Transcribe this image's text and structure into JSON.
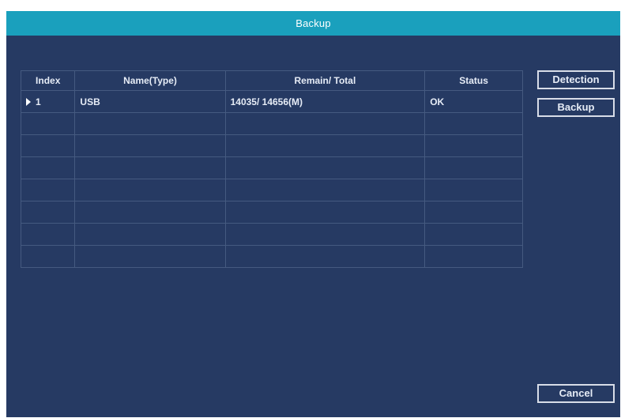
{
  "window": {
    "title": "Backup"
  },
  "table": {
    "columns": [
      "Index",
      "Name(Type)",
      "Remain/ Total",
      "Status"
    ],
    "rows": [
      {
        "index": "1",
        "name": "USB",
        "remain_total": "14035/ 14656(M)",
        "status": "OK"
      }
    ],
    "empty_rows": 7
  },
  "buttons": {
    "detection": "Detection",
    "backup": "Backup",
    "cancel": "Cancel"
  },
  "colors": {
    "titlebar": "#1aa0bd",
    "panel": "#263a63",
    "grid": "#455a80"
  },
  "icons": {
    "selected_row": "play-arrow-icon"
  }
}
